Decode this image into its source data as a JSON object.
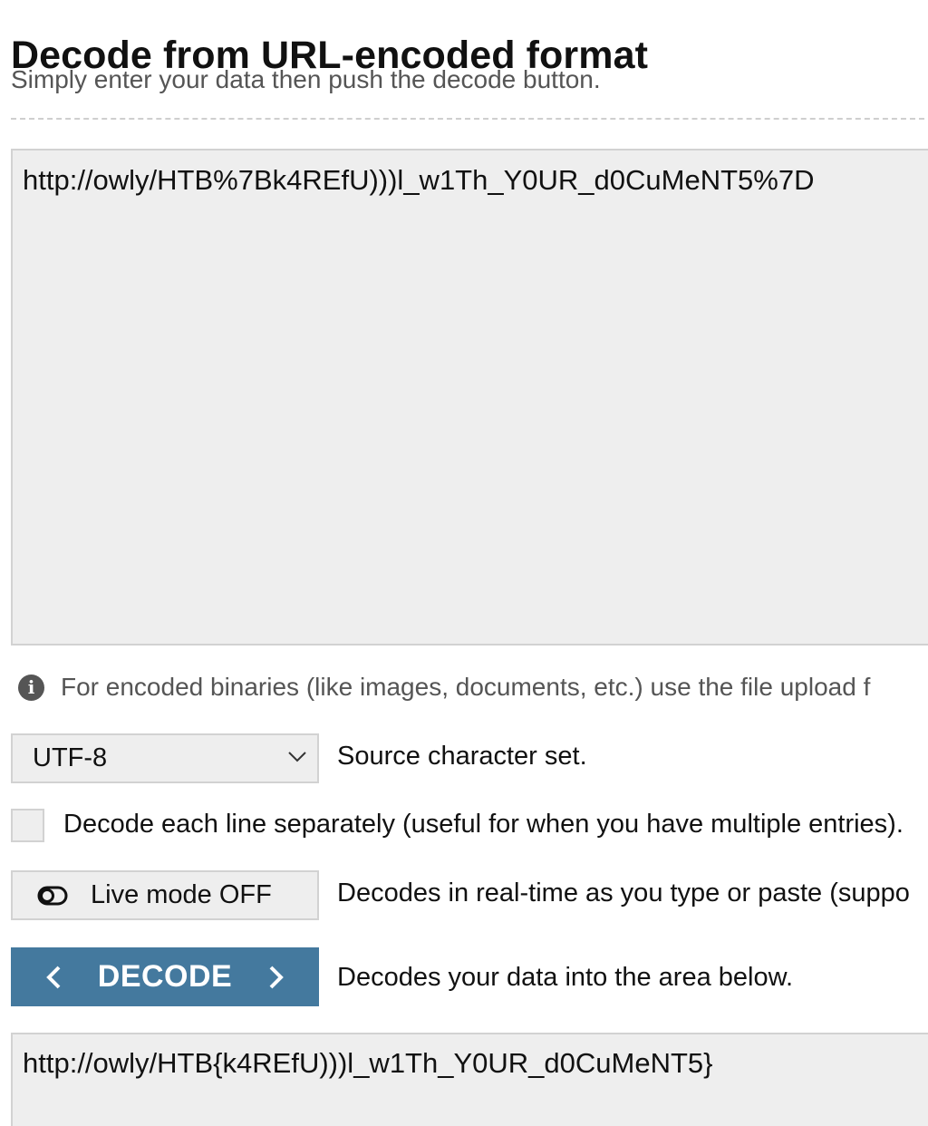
{
  "header": {
    "title": "Decode from URL-encoded format",
    "subtitle": "Simply enter your data then push the decode button."
  },
  "input": {
    "value": "http://owly/HTB%7Bk4REfU)))l_w1Th_Y0UR_d0CuMeNT5%7D"
  },
  "info": {
    "icon": "info-icon",
    "text": "For encoded binaries (like images, documents, etc.) use the file upload f"
  },
  "charset": {
    "selected": "UTF-8",
    "label": "Source character set."
  },
  "line_option": {
    "checked": false,
    "label": "Decode each line separately (useful for when you have multiple entries)."
  },
  "live_mode": {
    "button_label": "Live mode OFF",
    "description": "Decodes in real-time as you type or paste (suppo"
  },
  "decode": {
    "button_label": "DECODE",
    "description": "Decodes your data into the area below."
  },
  "output": {
    "value": "http://owly/HTB{k4REfU)))l_w1Th_Y0UR_d0CuMeNT5}"
  },
  "colors": {
    "decode_button": "#44799e",
    "field_background": "#eeeeee",
    "field_border": "#d2d2d2"
  }
}
